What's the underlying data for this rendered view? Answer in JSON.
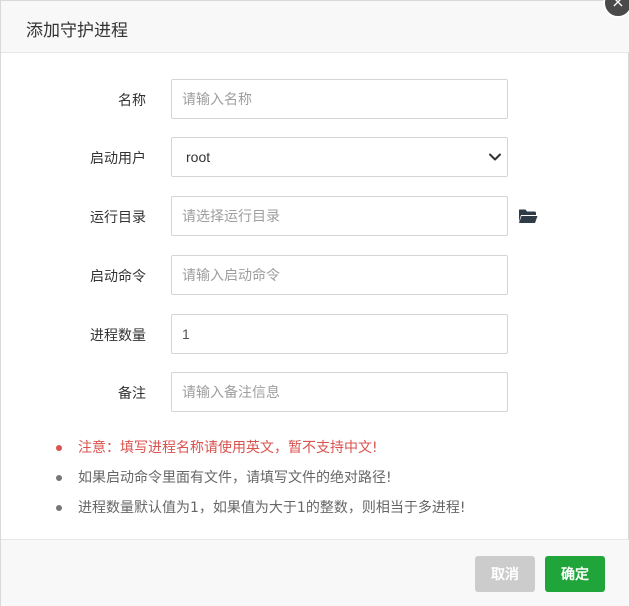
{
  "dialog": {
    "title": "添加守护进程",
    "close_icon": "close-icon"
  },
  "form": {
    "name": {
      "label": "名称",
      "placeholder": "请输入名称"
    },
    "user": {
      "label": "启动用户",
      "value": "root",
      "options": [
        "root"
      ]
    },
    "dir": {
      "label": "运行目录",
      "placeholder": "请选择运行目录",
      "icon": "folder-open-icon"
    },
    "command": {
      "label": "启动命令",
      "placeholder": "请输入启动命令"
    },
    "count": {
      "label": "进程数量",
      "value": "1"
    },
    "remark": {
      "label": "备注",
      "placeholder": "请输入备注信息"
    }
  },
  "notes": [
    "注意：填写进程名称请使用英文，暂不支持中文!",
    "如果启动命令里面有文件，请填写文件的绝对路径!",
    "进程数量默认值为1，如果值为大于1的整数，则相当于多进程!"
  ],
  "footer": {
    "cancel_label": "取消",
    "confirm_label": "确定"
  },
  "colors": {
    "confirm": "#20a53a",
    "cancel": "#cccccc",
    "warning": "#d9534f"
  }
}
